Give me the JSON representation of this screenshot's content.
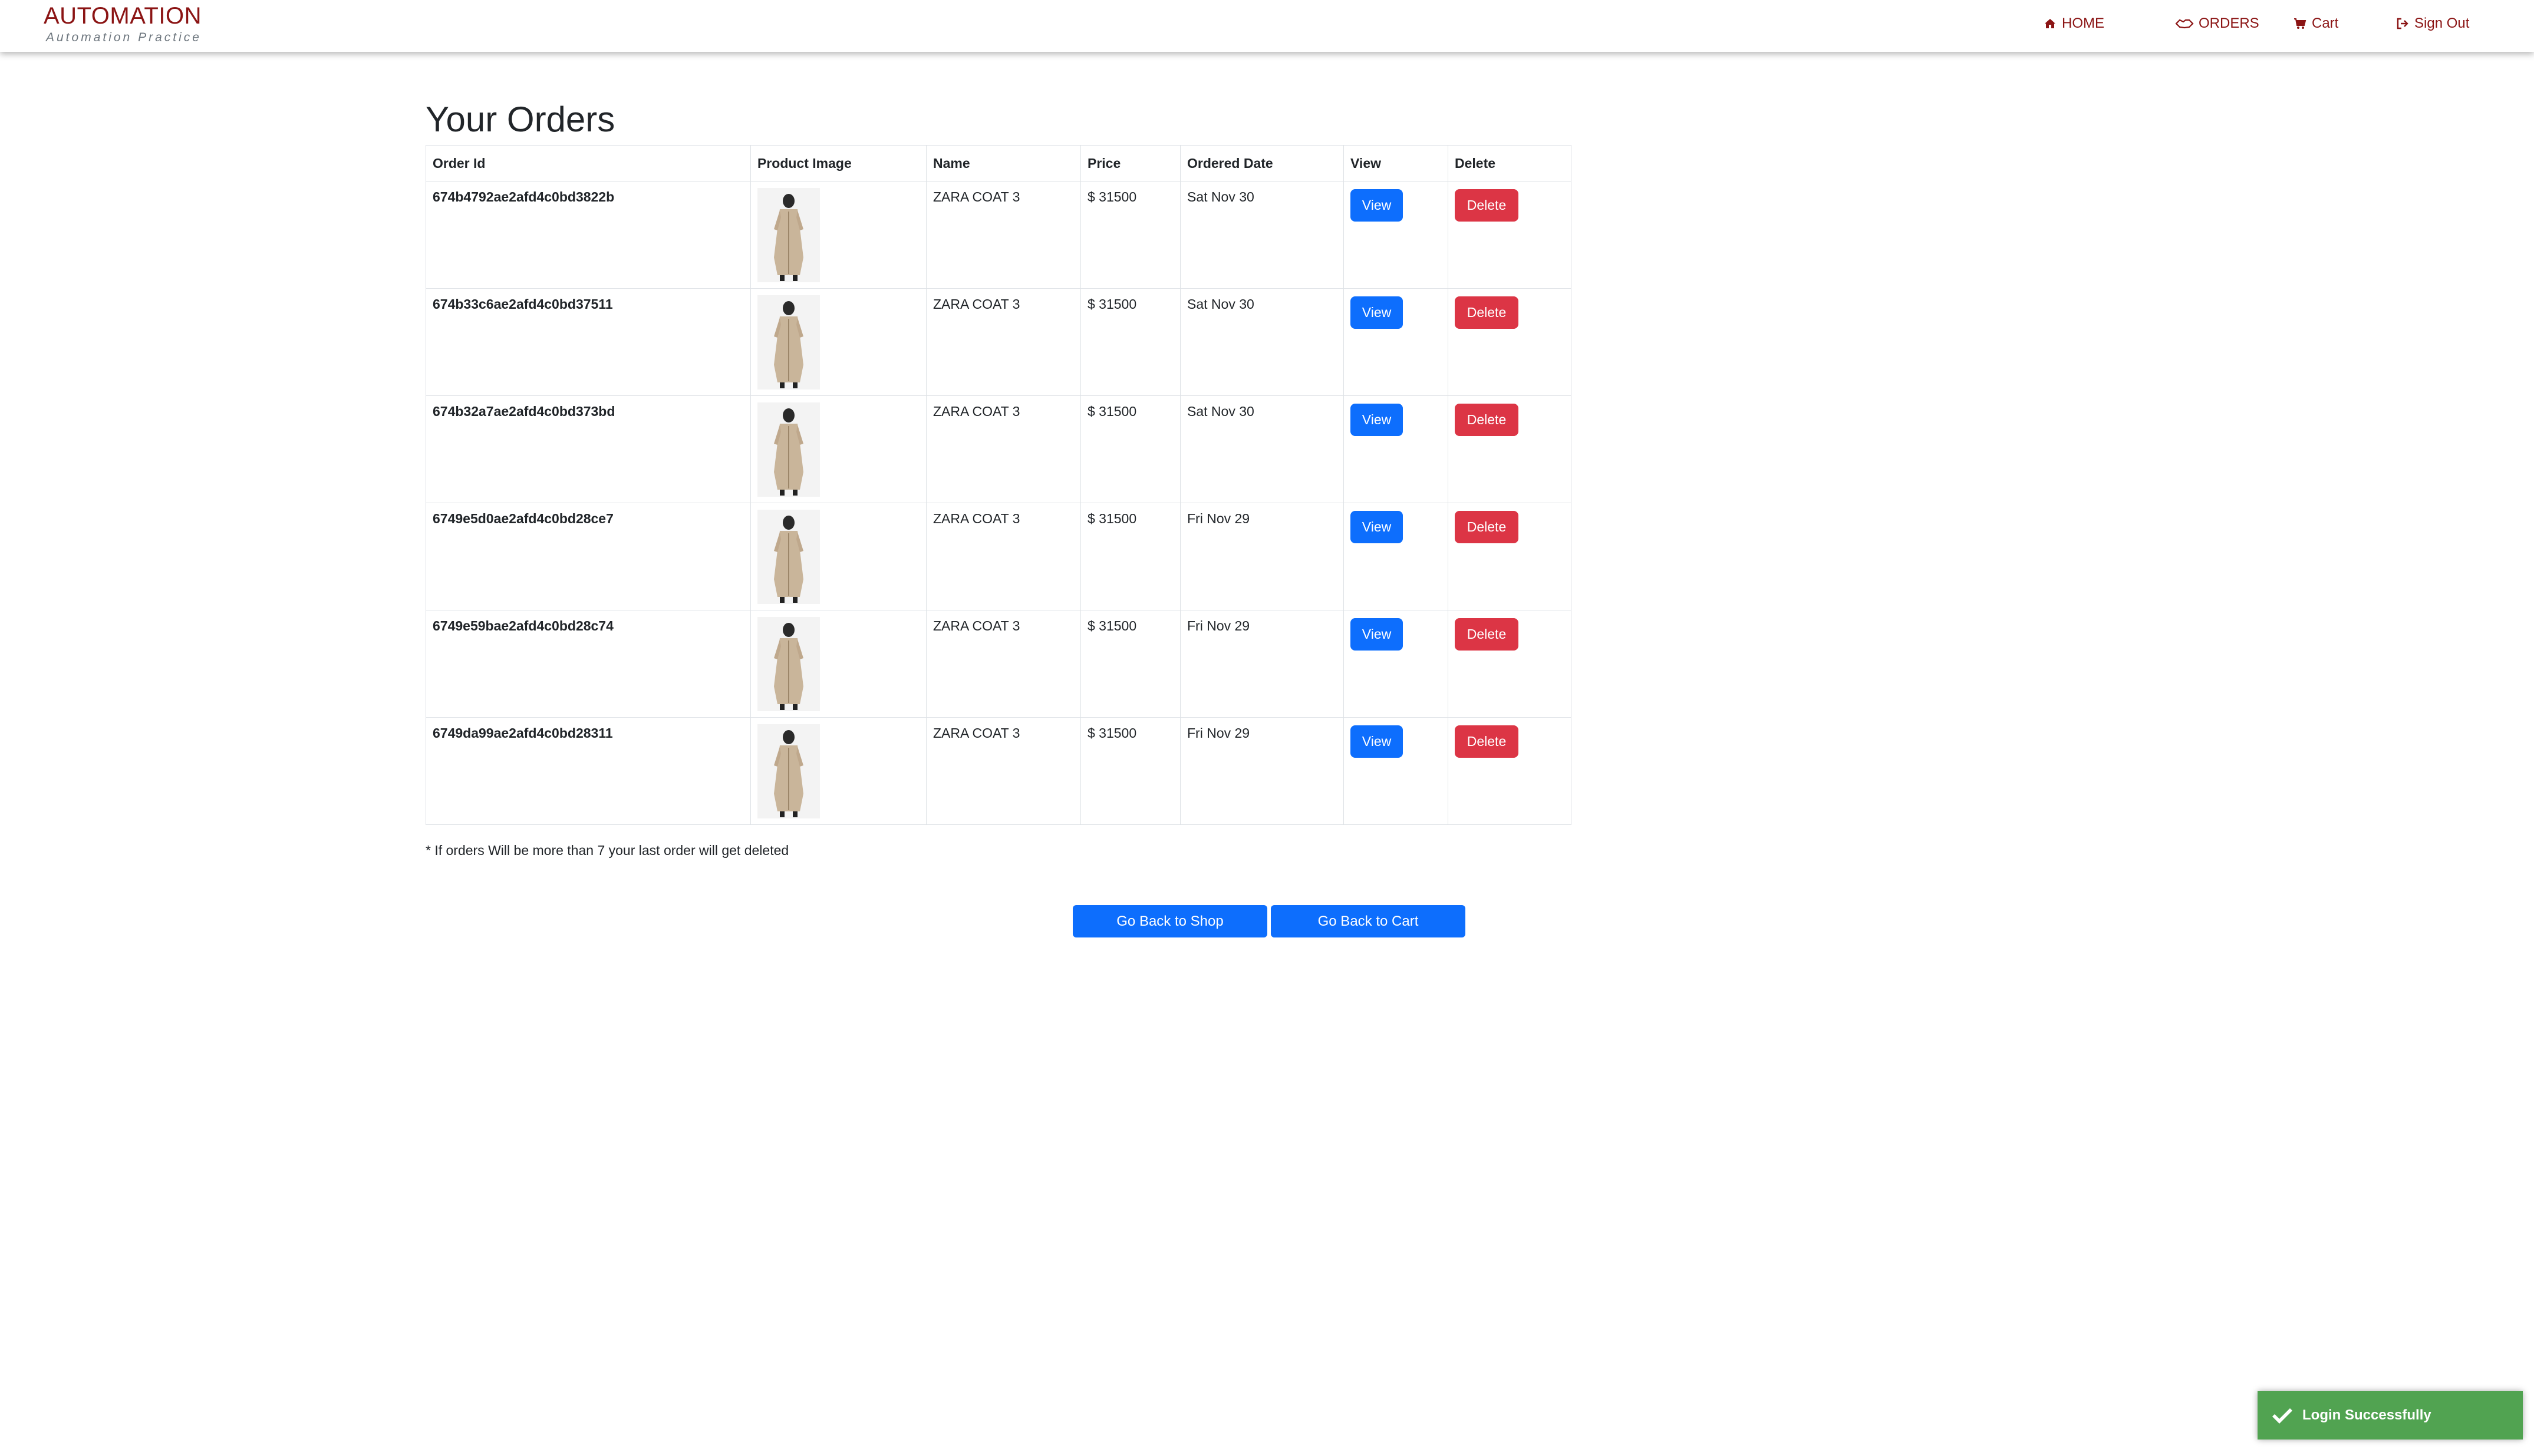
{
  "brand": {
    "title": "AUTOMATION",
    "subtitle": "Automation Practice"
  },
  "nav": {
    "home": "HOME",
    "orders": "ORDERS",
    "cart": "Cart",
    "signout": "Sign Out"
  },
  "page_title": "Your Orders",
  "table": {
    "headers": [
      "Order Id",
      "Product Image",
      "Name",
      "Price",
      "Ordered Date",
      "View",
      "Delete"
    ],
    "rows": [
      {
        "order_id": "674b4792ae2afd4c0bd3822b",
        "name": "ZARA COAT 3",
        "price": "$ 31500",
        "date": "Sat Nov 30",
        "view": "View",
        "delete": "Delete"
      },
      {
        "order_id": "674b33c6ae2afd4c0bd37511",
        "name": "ZARA COAT 3",
        "price": "$ 31500",
        "date": "Sat Nov 30",
        "view": "View",
        "delete": "Delete"
      },
      {
        "order_id": "674b32a7ae2afd4c0bd373bd",
        "name": "ZARA COAT 3",
        "price": "$ 31500",
        "date": "Sat Nov 30",
        "view": "View",
        "delete": "Delete"
      },
      {
        "order_id": "6749e5d0ae2afd4c0bd28ce7",
        "name": "ZARA COAT 3",
        "price": "$ 31500",
        "date": "Fri Nov 29",
        "view": "View",
        "delete": "Delete"
      },
      {
        "order_id": "6749e59bae2afd4c0bd28c74",
        "name": "ZARA COAT 3",
        "price": "$ 31500",
        "date": "Fri Nov 29",
        "view": "View",
        "delete": "Delete"
      },
      {
        "order_id": "6749da99ae2afd4c0bd28311",
        "name": "ZARA COAT 3",
        "price": "$ 31500",
        "date": "Fri Nov 29",
        "view": "View",
        "delete": "Delete"
      }
    ]
  },
  "note": "* If orders Will be more than 7 your last order will get deleted",
  "buttons": {
    "shop": "Go Back to Shop",
    "cart": "Go Back to Cart"
  },
  "toast": {
    "message": "Login Successfully"
  },
  "colors": {
    "brand": "#8b1414",
    "primary": "#0d6efd",
    "danger": "#dc3545",
    "success": "#51a351"
  }
}
